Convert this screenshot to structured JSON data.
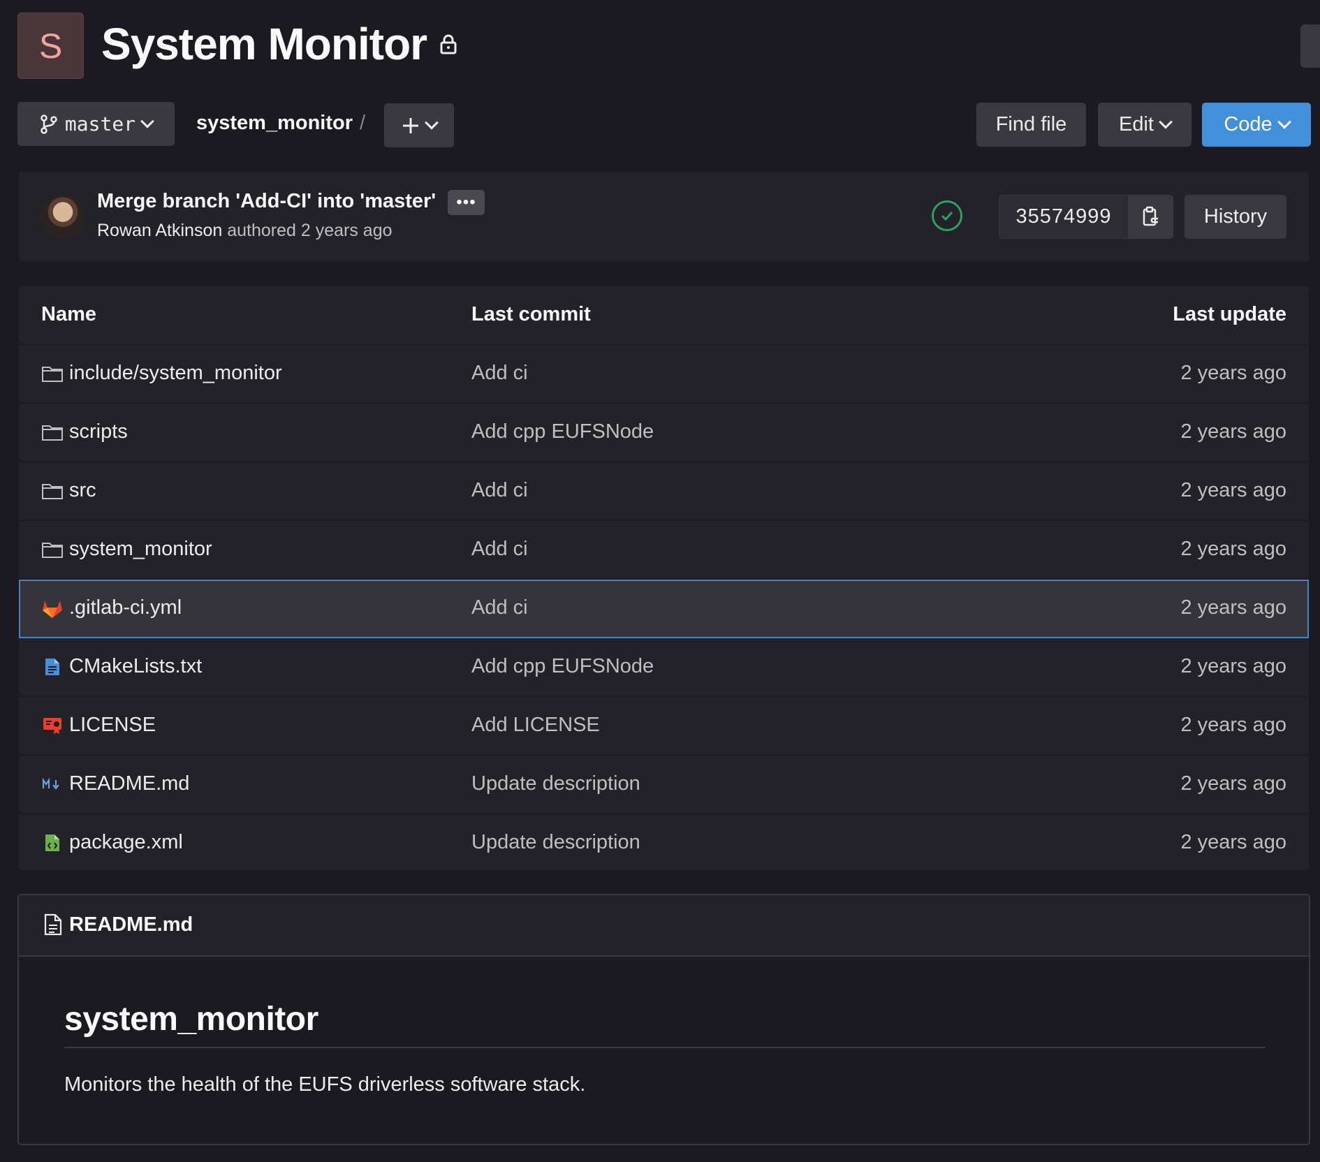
{
  "project": {
    "initial": "S",
    "name": "System Monitor"
  },
  "toolbar": {
    "branch": "master",
    "path": "system_monitor",
    "path_separator": "/",
    "find_file": "Find file",
    "edit": "Edit",
    "code": "Code"
  },
  "commit": {
    "title": "Merge branch 'Add-CI' into 'master'",
    "ellipsis": "•••",
    "author": "Rowan Atkinson",
    "authored": "authored 2 years ago",
    "sha": "35574999",
    "history": "History"
  },
  "table": {
    "headers": {
      "name": "Name",
      "last_commit": "Last commit",
      "last_update": "Last update"
    },
    "rows": [
      {
        "name": "include/system_monitor",
        "commit": "Add ci",
        "date": "2 years ago",
        "icon": "folder-icon"
      },
      {
        "name": "scripts",
        "commit": "Add cpp EUFSNode",
        "date": "2 years ago",
        "icon": "folder-icon"
      },
      {
        "name": "src",
        "commit": "Add ci",
        "date": "2 years ago",
        "icon": "folder-icon"
      },
      {
        "name": "system_monitor",
        "commit": "Add ci",
        "date": "2 years ago",
        "icon": "folder-icon"
      },
      {
        "name": ".gitlab-ci.yml",
        "commit": "Add ci",
        "date": "2 years ago",
        "icon": "gitlab-icon"
      },
      {
        "name": "CMakeLists.txt",
        "commit": "Add cpp EUFSNode",
        "date": "2 years ago",
        "icon": "document-icon"
      },
      {
        "name": "LICENSE",
        "commit": "Add LICENSE",
        "date": "2 years ago",
        "icon": "license-icon"
      },
      {
        "name": "README.md",
        "commit": "Update description",
        "date": "2 years ago",
        "icon": "markdown-icon"
      },
      {
        "name": "package.xml",
        "commit": "Update description",
        "date": "2 years ago",
        "icon": "xml-file-icon"
      }
    ]
  },
  "readme": {
    "file": "README.md",
    "heading": "system_monitor",
    "description": "Monitors the health of the EUFS driverless software stack."
  },
  "colors": {
    "background": "#1b1a20",
    "panel": "#232228",
    "button": "#3a393f",
    "accent_blue": "#428fdc",
    "success_green": "#2da160",
    "gitlab_orange": "#e2432a"
  }
}
